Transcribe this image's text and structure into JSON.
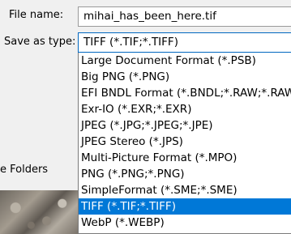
{
  "file_name": {
    "label": "File name:",
    "value": "mihai_has_been_here.tif"
  },
  "save_as_type": {
    "label": "Save as type:",
    "selected": "TIFF (*.TIF;*.TIFF)",
    "options": [
      "Large Document Format (*.PSB)",
      "Big PNG (*.PNG)",
      "EFI BNDL Format (*.BNDL;*.RAW;*.RAW)",
      "Exr-IO (*.EXR;*.EXR)",
      "JPEG (*.JPG;*.JPEG;*.JPE)",
      "JPEG Stereo (*.JPS)",
      "Multi-Picture Format (*.MPO)",
      "PNG (*.PNG;*.PNG)",
      "SimpleFormat (*.SME;*.SME)",
      "TIFF (*.TIF;*.TIFF)",
      "WebP (*.WEBP)"
    ],
    "highlighted_index": 9
  },
  "hide_folders": {
    "label": "e Folders"
  },
  "colors": {
    "focus_border": "#0067c0",
    "highlight": "#0078d7"
  }
}
